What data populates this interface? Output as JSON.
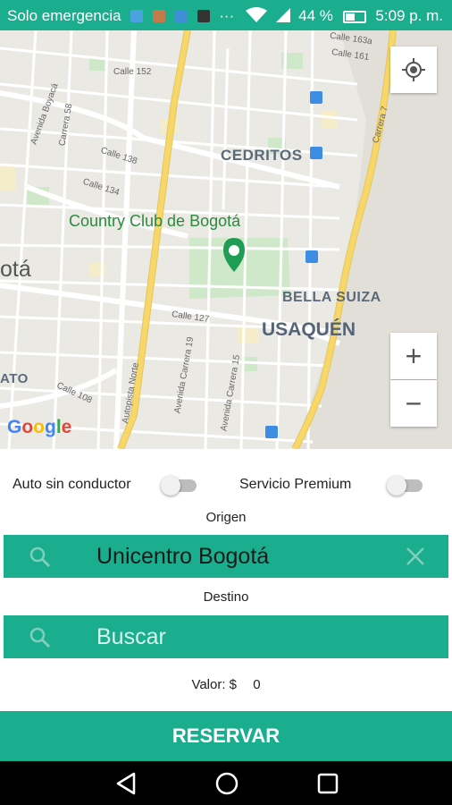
{
  "status_bar": {
    "carrier": "Solo emergencia",
    "battery": "44 %",
    "time": "5:09 p. m.",
    "dots": "···"
  },
  "map": {
    "districts": [
      "CEDRITOS",
      "BELLA SUIZA",
      "USAQUÉN",
      "ATO"
    ],
    "city": "otá",
    "park": "Country Club de Bogotá",
    "streets": [
      "Calle 152",
      "Calle 138",
      "Calle 134",
      "Calle 127",
      "Calle 161",
      "Calle 163a",
      "Avenida Carrera 19",
      "Avenida Carrera 15",
      "Autopista Norte",
      "Carrera 7",
      "Calle 108",
      "Avenida Boyacá",
      "Carrera 58"
    ],
    "attribution": "Google",
    "zoom_in": "+",
    "zoom_out": "−"
  },
  "form": {
    "toggle1_label": "Auto sin conductor",
    "toggle2_label": "Servicio Premium",
    "origin_label": "Origen",
    "origin_value": "Unicentro Bogotá",
    "destination_label": "Destino",
    "destination_placeholder": "Buscar",
    "price_label": "Valor: $",
    "price_value": "0",
    "reserve_button": "RESERVAR"
  },
  "colors": {
    "accent": "#1aad8e",
    "road_major": "#f7d66a"
  }
}
